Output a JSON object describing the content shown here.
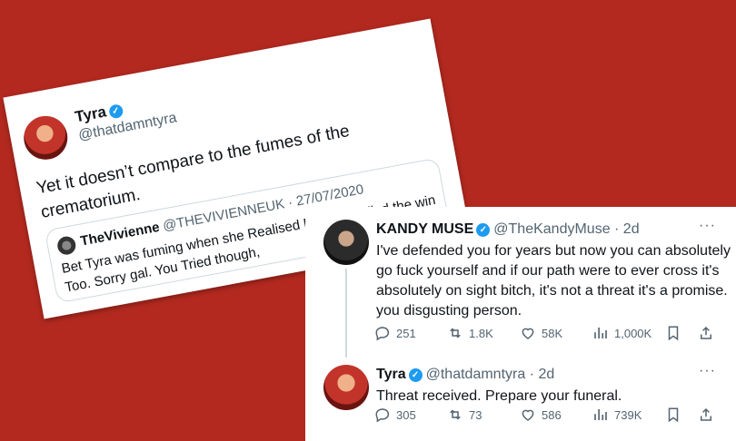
{
  "background_color": "#a8281f",
  "quoted_tweet_card": {
    "author_name": "Tyra",
    "author_handle": "@thatdamntyra",
    "text": "Yet it doesn’t compare to the fumes of the crematorium.",
    "quote": {
      "author_name": "TheVivienne",
      "author_handle": "@THEVIVIENNEUK · 27/07/2020",
      "text": "Bet Tyra was fuming when she Realised Netflix Spoiled the win Too. Sorry gal. You Tried though,"
    }
  },
  "thread": {
    "tweets": [
      {
        "author_name": "KANDY MUSE",
        "author_handle": "@TheKandyMuse · 2d",
        "text": "I've defended you for years but now you can absolutely go fuck yourself and if our path were to ever cross it's absolutely on sight bitch, it's not a threat it's a promise. you disgusting person.",
        "replies": "251",
        "retweets": "1.8K",
        "likes": "58K",
        "views": "1,000K"
      },
      {
        "author_name": "Tyra",
        "author_handle": "@thatdamntyra · 2d",
        "text": "Threat received. Prepare your funeral.",
        "replies": "305",
        "retweets": "73",
        "likes": "586",
        "views": "739K"
      }
    ]
  },
  "icons": [
    "verified-badge-icon",
    "more-options-icon",
    "reply-icon",
    "retweet-icon",
    "like-icon",
    "views-icon",
    "bookmark-icon",
    "share-icon"
  ]
}
